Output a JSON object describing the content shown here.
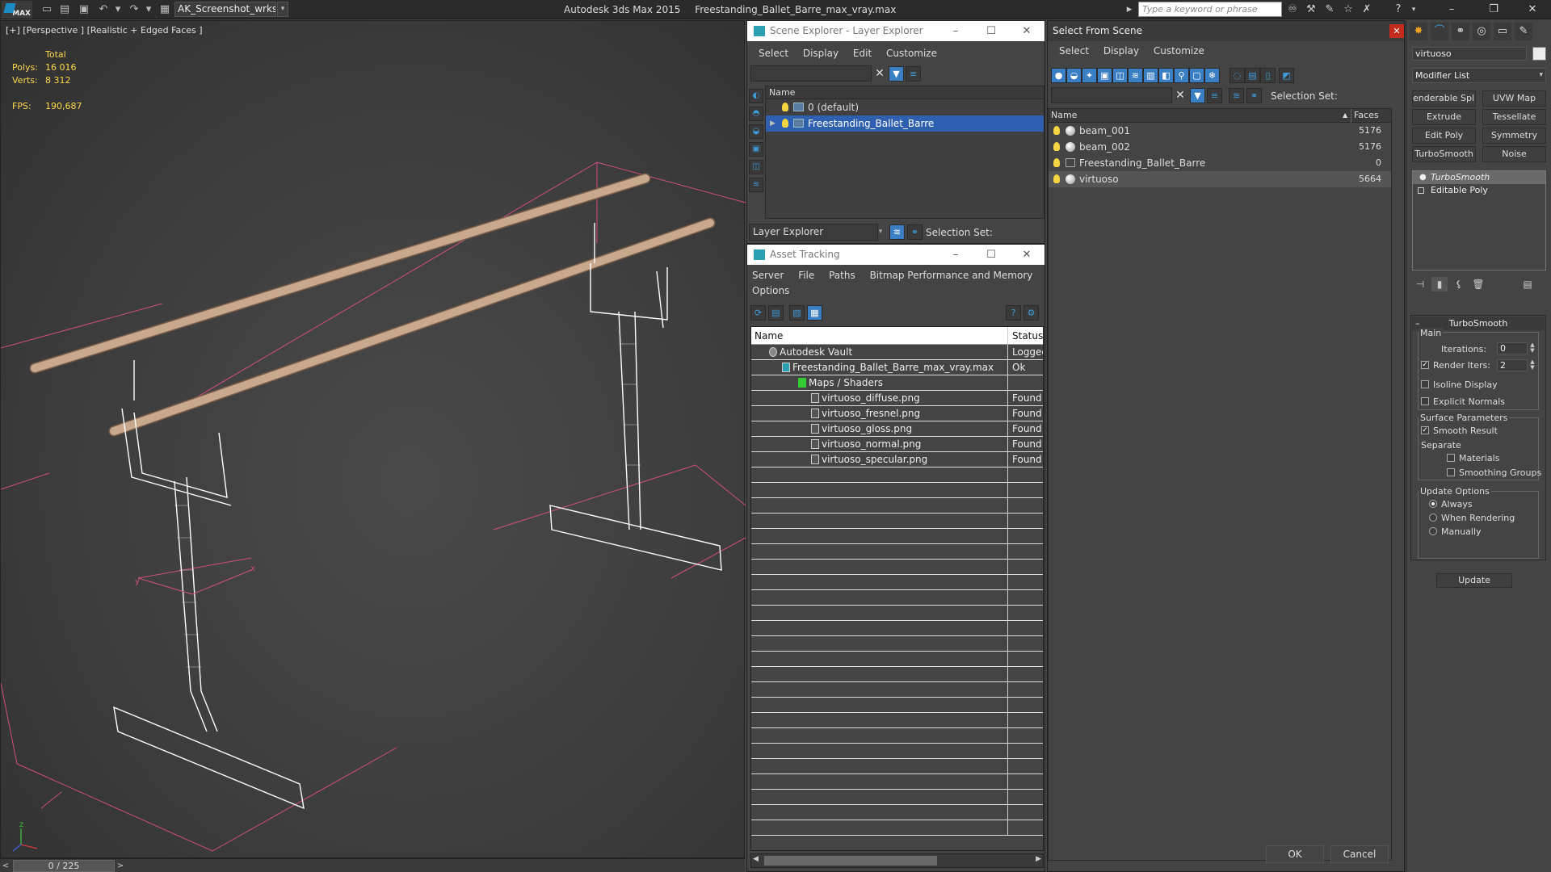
{
  "titlebar": {
    "logo": "MAX",
    "workspace": "AK_Screenshot_wrksp",
    "app_name": "Autodesk 3ds Max  2015",
    "file_name": "Freestanding_Ballet_Barre_max_vray.max",
    "search_placeholder": "Type a keyword or phrase"
  },
  "viewport": {
    "label": "[+] [Perspective ] [Realistic + Edged Faces ]",
    "stats": {
      "total_label": "Total",
      "polys_label": "Polys:",
      "polys_value": "16 016",
      "verts_label": "Verts:",
      "verts_value": "8 312",
      "fps_label": "FPS:",
      "fps_value": "190,687"
    },
    "axis_labels": [
      "x",
      "y",
      "z"
    ]
  },
  "timeslider": {
    "value": "0 / 225",
    "prev": "<",
    "next": ">"
  },
  "scene_explorer": {
    "title": "Scene Explorer - Layer Explorer",
    "menu": [
      "Select",
      "Display",
      "Edit",
      "Customize"
    ],
    "column_name": "Name",
    "layers": [
      {
        "name": "0 (default)",
        "selected": false
      },
      {
        "name": "Freestanding_Ballet_Barre",
        "selected": true
      }
    ],
    "footer_dropdown": "Layer Explorer",
    "selection_set_label": "Selection Set:"
  },
  "asset_tracking": {
    "title": "Asset Tracking",
    "menu_row1": [
      "Server",
      "File",
      "Paths",
      "Bitmap Performance and Memory"
    ],
    "menu_row2": [
      "Options"
    ],
    "columns": {
      "name": "Name",
      "status": "Status"
    },
    "rows": [
      {
        "name": "Autodesk Vault",
        "status": "Logged",
        "indent": 1
      },
      {
        "name": "Freestanding_Ballet_Barre_max_vray.max",
        "status": "Ok",
        "indent": 2
      },
      {
        "name": "Maps / Shaders",
        "status": "",
        "indent": 3
      },
      {
        "name": "virtuoso_diffuse.png",
        "status": "Found",
        "indent": 4
      },
      {
        "name": "virtuoso_fresnel.png",
        "status": "Found",
        "indent": 4
      },
      {
        "name": "virtuoso_gloss.png",
        "status": "Found",
        "indent": 4
      },
      {
        "name": "virtuoso_normal.png",
        "status": "Found",
        "indent": 4
      },
      {
        "name": "virtuoso_specular.png",
        "status": "Found",
        "indent": 4
      }
    ]
  },
  "select_from_scene": {
    "title": "Select From Scene",
    "menu": [
      "Select",
      "Display",
      "Customize"
    ],
    "selection_set_label": "Selection Set:",
    "columns": {
      "name": "Name",
      "faces": "Faces"
    },
    "objects": [
      {
        "name": "beam_001",
        "faces": "5176",
        "selected": false
      },
      {
        "name": "beam_002",
        "faces": "5176",
        "selected": false
      },
      {
        "name": "Freestanding_Ballet_Barre",
        "faces": "0",
        "selected": false
      },
      {
        "name": "virtuoso",
        "faces": "5664",
        "selected": true
      }
    ],
    "ok_label": "OK",
    "cancel_label": "Cancel"
  },
  "command_panel": {
    "object_name": "virtuoso",
    "modifier_list": "Modifier List",
    "modifier_buttons": [
      "enderable Spli",
      "UVW Map",
      "Extrude",
      "Tessellate",
      "Edit Poly",
      "Symmetry",
      "TurboSmooth",
      "Noise"
    ],
    "stack": [
      {
        "name": "TurboSmooth",
        "selected": true
      },
      {
        "name": "Editable Poly",
        "selected": false
      }
    ],
    "turbosmooth": {
      "title": "TurboSmooth",
      "main_label": "Main",
      "iterations_label": "Iterations:",
      "iterations_value": "0",
      "render_iters_label": "Render Iters:",
      "render_iters_value": "2",
      "isoline_label": "Isoline Display",
      "explicit_normals_label": "Explicit Normals",
      "surface_params_label": "Surface Parameters",
      "smooth_result_label": "Smooth Result",
      "separate_label": "Separate",
      "materials_label": "Materials",
      "smoothing_groups_label": "Smoothing Groups",
      "update_options_label": "Update Options",
      "always_label": "Always",
      "when_rendering_label": "When Rendering",
      "manually_label": "Manually",
      "update_button": "Update"
    }
  },
  "colors": {
    "selection_blue": "#2f60b0",
    "stats_yellow": "#ffd94a",
    "close_red": "#c42b1c",
    "bbox_pink": "#e0508a",
    "barre_wood": "#c9a98e"
  }
}
